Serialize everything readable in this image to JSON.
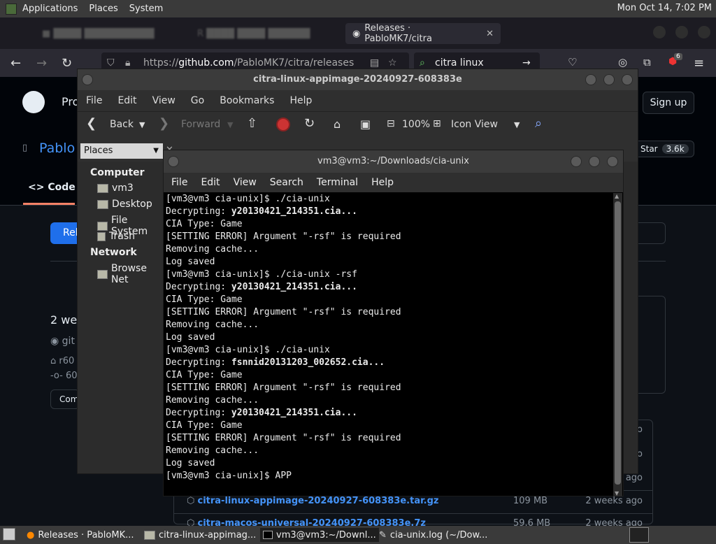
{
  "top_panel": {
    "menus": [
      "Applications",
      "Places",
      "System"
    ],
    "clock": "Mon Oct 14,  7:02 PM"
  },
  "browser": {
    "active_tab": "Releases · PabloMK7/citra",
    "url_host": "github.com",
    "url_prefix": "https://",
    "url_path": "/PabloMK7/citra/releases",
    "search_text": "citra linux",
    "ext_badge": "6"
  },
  "github": {
    "header_text": "Pro",
    "signup": "Sign up",
    "repo_owner": "Pablo",
    "star_label": "Star",
    "star_count": "3.6k",
    "code_tab": "Code",
    "rel_btn": "Rel",
    "weeks": "2 wee",
    "git_frag": "git",
    "tag_frag": "r60",
    "commit_frag": "60",
    "compare_frag": "Com",
    "assets": [
      {
        "name": "",
        "size": "",
        "date": "ago"
      },
      {
        "name": "",
        "size": "",
        "date": "go"
      },
      {
        "name": "",
        "size": "",
        "date": "ago"
      },
      {
        "name": "citra-linux-appimage-20240927-608383e.tar.gz",
        "size": "109 MB",
        "date": "2 weeks ago"
      },
      {
        "name": "citra-macos-universal-20240927-608383e.7z",
        "size": "59.6 MB",
        "date": "2 weeks ago"
      }
    ]
  },
  "file_manager": {
    "title": "citra-linux-appimage-20240927-608383e",
    "menu": [
      "File",
      "Edit",
      "View",
      "Go",
      "Bookmarks",
      "Help"
    ],
    "toolbar": {
      "back": "Back",
      "forward": "Forward",
      "zoom": "100%",
      "view_mode": "Icon View"
    },
    "places_select": "Places",
    "sidebar": {
      "computer_header": "Computer",
      "computer_items": [
        "vm3",
        "Desktop",
        "File System",
        "Trash"
      ],
      "network_header": "Network",
      "network_items": [
        "Browse Net"
      ]
    }
  },
  "terminal": {
    "title": "vm3@vm3:~/Downloads/cia-unix",
    "menu": [
      "File",
      "Edit",
      "View",
      "Search",
      "Terminal",
      "Help"
    ],
    "lines": [
      {
        "plain": "[vm3@vm3 cia-unix]$ ./cia-unix",
        "bold": ""
      },
      {
        "plain": "Decrypting: ",
        "bold": "y20130421_214351.cia..."
      },
      {
        "plain": "CIA Type: Game",
        "bold": ""
      },
      {
        "plain": "[SETTING ERROR] Argument \"-rsf\" is required",
        "bold": ""
      },
      {
        "plain": "Removing cache...",
        "bold": ""
      },
      {
        "plain": "Log saved",
        "bold": ""
      },
      {
        "plain": "[vm3@vm3 cia-unix]$ ./cia-unix -rsf",
        "bold": ""
      },
      {
        "plain": "Decrypting: ",
        "bold": "y20130421_214351.cia..."
      },
      {
        "plain": "CIA Type: Game",
        "bold": ""
      },
      {
        "plain": "[SETTING ERROR] Argument \"-rsf\" is required",
        "bold": ""
      },
      {
        "plain": "Removing cache...",
        "bold": ""
      },
      {
        "plain": "Log saved",
        "bold": ""
      },
      {
        "plain": "[vm3@vm3 cia-unix]$ ./cia-unix",
        "bold": ""
      },
      {
        "plain": "Decrypting: ",
        "bold": "fsnnid20131203_002652.cia..."
      },
      {
        "plain": "CIA Type: Game",
        "bold": ""
      },
      {
        "plain": "[SETTING ERROR] Argument \"-rsf\" is required",
        "bold": ""
      },
      {
        "plain": "Removing cache...",
        "bold": ""
      },
      {
        "plain": "Decrypting: ",
        "bold": "y20130421_214351.cia..."
      },
      {
        "plain": "CIA Type: Game",
        "bold": ""
      },
      {
        "plain": "[SETTING ERROR] Argument \"-rsf\" is required",
        "bold": ""
      },
      {
        "plain": "Removing cache...",
        "bold": ""
      },
      {
        "plain": "Log saved",
        "bold": ""
      },
      {
        "plain": "[vm3@vm3 cia-unix]$ APP",
        "bold": ""
      }
    ]
  },
  "taskbar": {
    "tasks": [
      "Releases · PabloMK...",
      "citra-linux-appimag...",
      "vm3@vm3:~/Downl...",
      "cia-unix.log (~/Dow..."
    ]
  }
}
